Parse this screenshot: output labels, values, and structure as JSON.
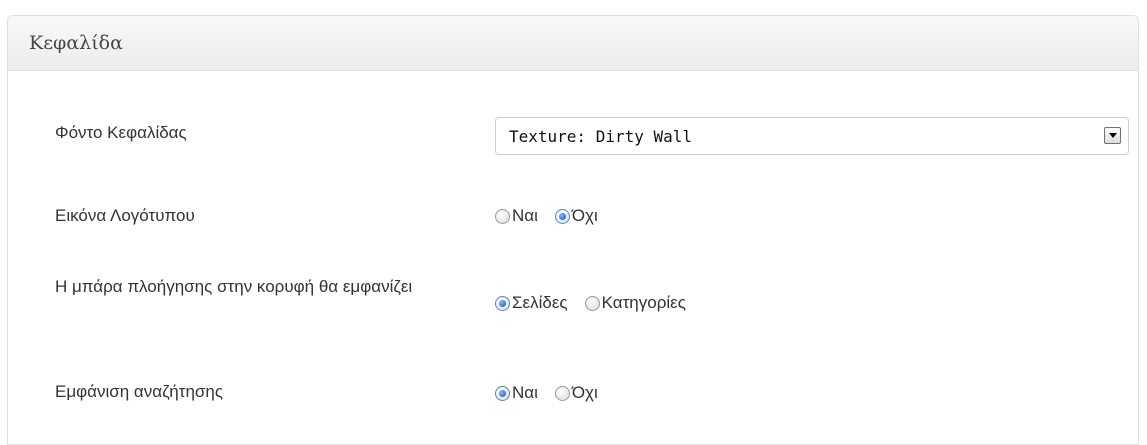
{
  "section": {
    "title": "Κεφαλίδα"
  },
  "rows": [
    {
      "label": "Φόντο Κεφαλίδας",
      "control": "select",
      "value": "Texture: Dirty Wall"
    },
    {
      "label": "Εικόνα Λογότυπου",
      "control": "radio",
      "options": [
        "Ναι",
        "Όχι"
      ],
      "selected": "Όχι"
    },
    {
      "label": "Η μπάρα πλοήγησης στην κορυφή θα εμφανίζει",
      "control": "radio",
      "options": [
        "Σελίδες",
        "Κατηγορίες"
      ],
      "selected": "Σελίδες"
    },
    {
      "label": "Εμφάνιση αναζήτησης",
      "control": "radio",
      "options": [
        "Ναι",
        "Όχι"
      ],
      "selected": "Ναι"
    }
  ]
}
